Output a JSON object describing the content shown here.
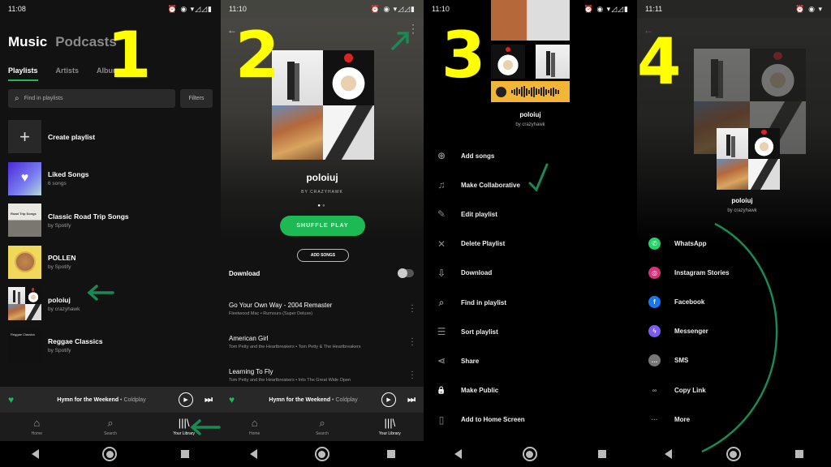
{
  "steps": [
    "1",
    "2",
    "3",
    "4"
  ],
  "colors": {
    "accent": "#1db954",
    "annotation_arrow": "#1a8a55",
    "step_number": "#ffff00"
  },
  "panel1": {
    "time": "11:08",
    "header": {
      "music": "Music",
      "podcasts": "Podcasts"
    },
    "tabs": [
      "Playlists",
      "Artists",
      "Albums"
    ],
    "search_placeholder": "Find in playlists",
    "filters": "Filters",
    "items": [
      {
        "title": "Create playlist",
        "sub": "",
        "icon": "plus-icon"
      },
      {
        "title": "Liked Songs",
        "sub": "6 songs",
        "icon": "heart-icon"
      },
      {
        "title": "Classic Road Trip Songs",
        "sub": "by Spotify"
      },
      {
        "title": "POLLEN",
        "sub": "by Spotify"
      },
      {
        "title": "poloiuj",
        "sub": "by crazyhawk"
      },
      {
        "title": "Reggae Classics",
        "sub": "by Spotify"
      }
    ]
  },
  "miniplayer": {
    "track": "Hymn for the Weekend",
    "separator": " • ",
    "artist": "Coldplay"
  },
  "bottomnav": [
    {
      "label": "Home",
      "icon": "home-icon"
    },
    {
      "label": "Search",
      "icon": "search-icon"
    },
    {
      "label": "Your Library",
      "icon": "library-icon"
    }
  ],
  "panel2": {
    "time": "11:10",
    "title": "poloiuj",
    "by": "BY CRAZYHAWK",
    "shuffle": "SHUFFLE PLAY",
    "add_songs": "ADD SONGS",
    "download": "Download",
    "download_enabled": false,
    "tracks": [
      {
        "title": "Go Your Own Way - 2004 Remaster",
        "sub": "Fleetwood Mac • Rumours (Super Deluxe)"
      },
      {
        "title": "American Girl",
        "sub": "Tom Petty and the Heartbreakers • Tom Petty & The Heartbreakers"
      },
      {
        "title": "Learning To Fly",
        "sub": "Tom Petty and the Heartbreakers • Into The Great Wide Open"
      }
    ]
  },
  "panel3": {
    "time": "11:10",
    "title": "poloiuj",
    "by": "by crazyhawk",
    "menu": [
      {
        "label": "Add songs",
        "icon": "⊕"
      },
      {
        "label": "Make Collaborative",
        "icon": "♫"
      },
      {
        "label": "Edit playlist",
        "icon": "✎"
      },
      {
        "label": "Delete Playlist",
        "icon": "✕"
      },
      {
        "label": "Download",
        "icon": "⇩"
      },
      {
        "label": "Find in playlist",
        "icon": "⌕"
      },
      {
        "label": "Sort playlist",
        "icon": "☰"
      },
      {
        "label": "Share",
        "icon": "⋖"
      },
      {
        "label": "Make Public",
        "icon": "🔒"
      },
      {
        "label": "Add to Home Screen",
        "icon": "▯"
      }
    ]
  },
  "panel4": {
    "time": "11:11",
    "title": "poloiuj",
    "by": "by crazyhawk",
    "share": [
      {
        "label": "WhatsApp",
        "glyph": "✆",
        "color": "#25d366"
      },
      {
        "label": "Instagram Stories",
        "glyph": "◎",
        "color": "#d6337a"
      },
      {
        "label": "Facebook",
        "glyph": "f",
        "color": "#1877f2"
      },
      {
        "label": "Messenger",
        "glyph": "ϟ",
        "color": "#7b5cf0"
      },
      {
        "label": "SMS",
        "glyph": "…",
        "color": "#777777"
      },
      {
        "label": "Copy Link",
        "glyph": "∞",
        "color": "transparent"
      },
      {
        "label": "More",
        "glyph": "···",
        "color": "transparent"
      }
    ]
  }
}
